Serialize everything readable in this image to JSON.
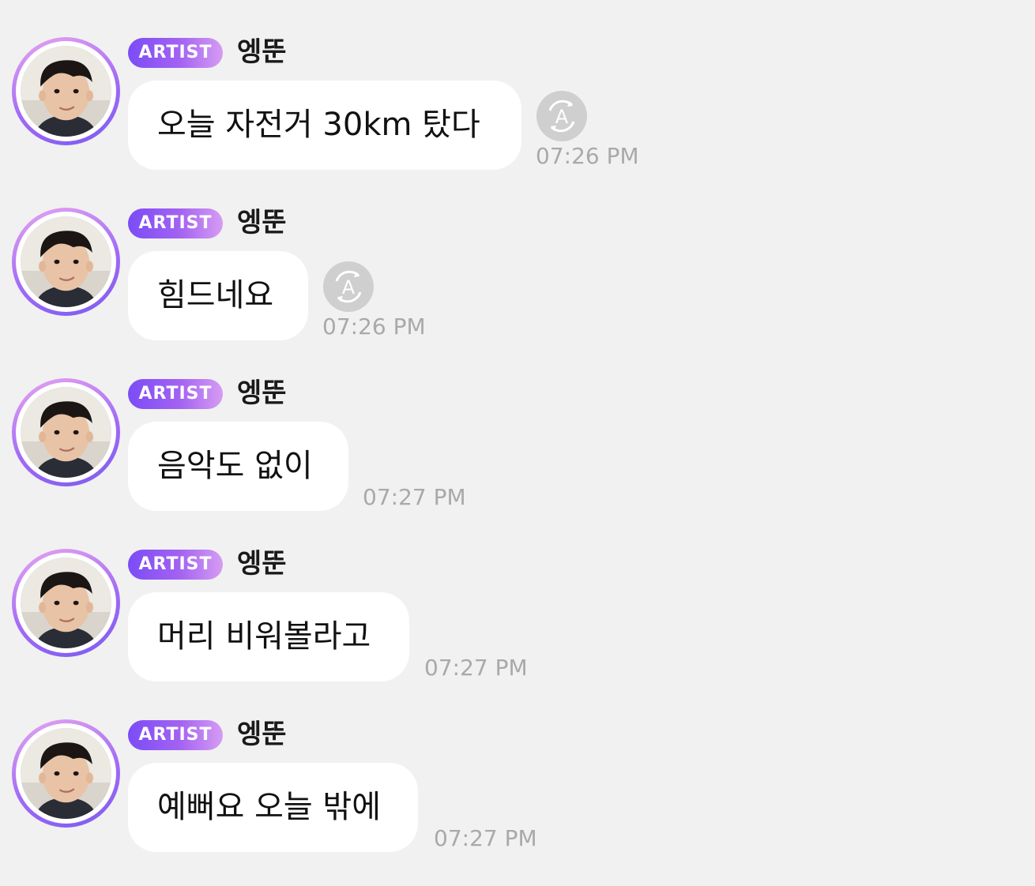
{
  "colors": {
    "background": "#f1f1f1",
    "bubble": "#ffffff",
    "badge_gradient_start": "#7b4cf6",
    "badge_gradient_end": "#d69cf3",
    "timestamp": "#a9a9a9",
    "translate_icon": "#cfcfcf"
  },
  "messages": [
    {
      "badge": "ARTIST",
      "sender": "엥뚠",
      "text": "오늘 자전거 30km 탔다",
      "time": "07:26 PM",
      "translate_icon": "translate-icon"
    },
    {
      "badge": "ARTIST",
      "sender": "엥뚠",
      "text": "힘드네요",
      "time": "07:26 PM",
      "translate_icon": "translate-icon"
    },
    {
      "badge": "ARTIST",
      "sender": "엥뚠",
      "text": "음악도 없이",
      "time": "07:27 PM"
    },
    {
      "badge": "ARTIST",
      "sender": "엥뚠",
      "text": "머리 비워볼라고",
      "time": "07:27 PM"
    },
    {
      "badge": "ARTIST",
      "sender": "엥뚠",
      "text": "예뻐요 오늘 밖에",
      "time": "07:27 PM"
    }
  ]
}
